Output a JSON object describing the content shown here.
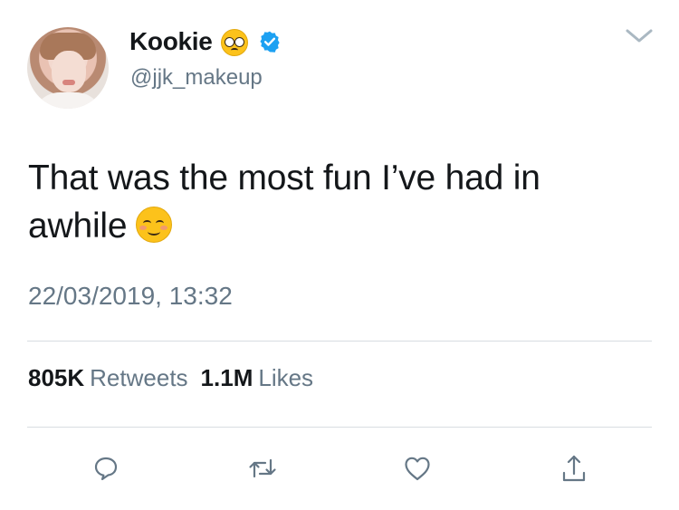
{
  "user": {
    "display_name": "Kookie",
    "handle": "@jjk_makeup",
    "verified": true,
    "name_emoji": "pleading-face-emoji"
  },
  "tweet": {
    "text_line1": "That was the most fun I’ve had in",
    "text_line2": "awhile",
    "trailing_emoji": "smiling-face-emoji",
    "timestamp": "22/03/2019, 13:32"
  },
  "stats": {
    "retweets_count": "805K",
    "retweets_label": "Retweets",
    "likes_count": "1.1M",
    "likes_label": "Likes"
  },
  "actions": [
    "reply-icon",
    "retweet-icon",
    "like-icon",
    "share-icon"
  ],
  "colors": {
    "text": "#14171a",
    "muted": "#657786",
    "verified_blue": "#1da1f2",
    "divider": "#d8dde1"
  }
}
